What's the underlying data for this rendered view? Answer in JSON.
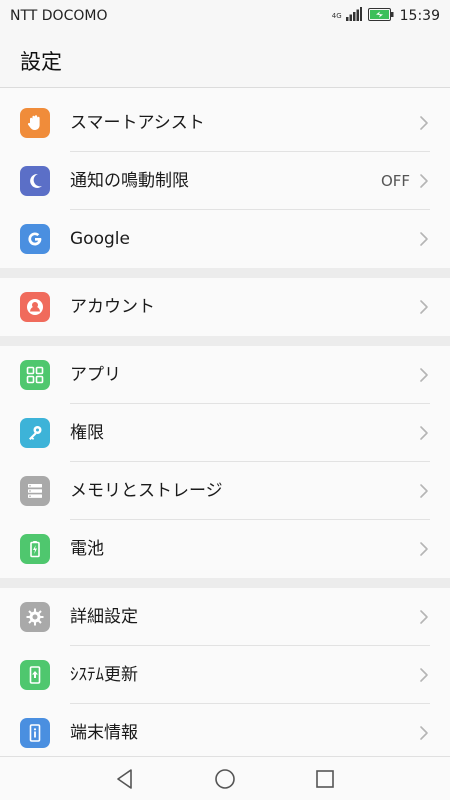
{
  "status_bar": {
    "carrier": "NTT DOCOMO",
    "network_type": "4G",
    "signal_icon": "signal-bars-icon",
    "battery_icon": "battery-charging-icon",
    "time": "15:39"
  },
  "header": {
    "title": "設定"
  },
  "groups": [
    {
      "items": [
        {
          "label": "スマートアシスト",
          "icon": "hand-icon",
          "color": "#f08c3a"
        },
        {
          "label": "通知の鳴動制限",
          "value": "OFF",
          "icon": "moon-icon",
          "color": "#5b6fc7"
        },
        {
          "label": "Google",
          "icon": "google-icon",
          "color": "#4a8fe0"
        }
      ]
    },
    {
      "items": [
        {
          "label": "アカウント",
          "icon": "account-icon",
          "color": "#f06b5c"
        }
      ]
    },
    {
      "items": [
        {
          "label": "アプリ",
          "icon": "apps-icon",
          "color": "#4fc76e"
        },
        {
          "label": "権限",
          "icon": "key-icon",
          "color": "#3db3d8"
        },
        {
          "label": "メモリとストレージ",
          "icon": "storage-icon",
          "color": "#a9a9a9"
        },
        {
          "label": "電池",
          "icon": "battery-icon",
          "color": "#4fc76e"
        }
      ]
    },
    {
      "items": [
        {
          "label": "詳細設定",
          "icon": "gear-icon",
          "color": "#a9a9a9"
        },
        {
          "label": "ｼｽﾃﾑ更新",
          "icon": "system-update-icon",
          "color": "#4fc76e"
        },
        {
          "label": "端末情報",
          "icon": "info-icon",
          "color": "#4a8fe0"
        }
      ]
    }
  ],
  "nav_bar": {
    "back_icon": "back-triangle-icon",
    "home_icon": "home-circle-icon",
    "recents_icon": "recents-square-icon"
  }
}
